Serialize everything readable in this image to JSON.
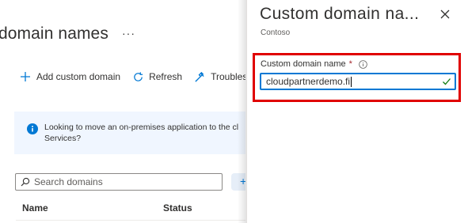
{
  "page": {
    "title": "domain names",
    "more_label": "···"
  },
  "toolbar": {
    "add_label": "Add custom domain",
    "refresh_label": "Refresh",
    "troubleshoot_label": "Troubleshoot"
  },
  "banner": {
    "line1": "Looking to move an on-premises application to the cl",
    "line2": "Services?"
  },
  "search": {
    "placeholder": "Search domains"
  },
  "table": {
    "columns": [
      "Name",
      "Status"
    ]
  },
  "panel": {
    "title": "Custom domain na...",
    "subtitle": "Contoso",
    "field_label": "Custom domain name",
    "required_mark": "*",
    "field_value": "cloudpartnerdemo.fi"
  },
  "colors": {
    "accent": "#0078d4",
    "highlight": "#e00000",
    "valid": "#107c10",
    "banner_bg": "#f0f6ff"
  }
}
